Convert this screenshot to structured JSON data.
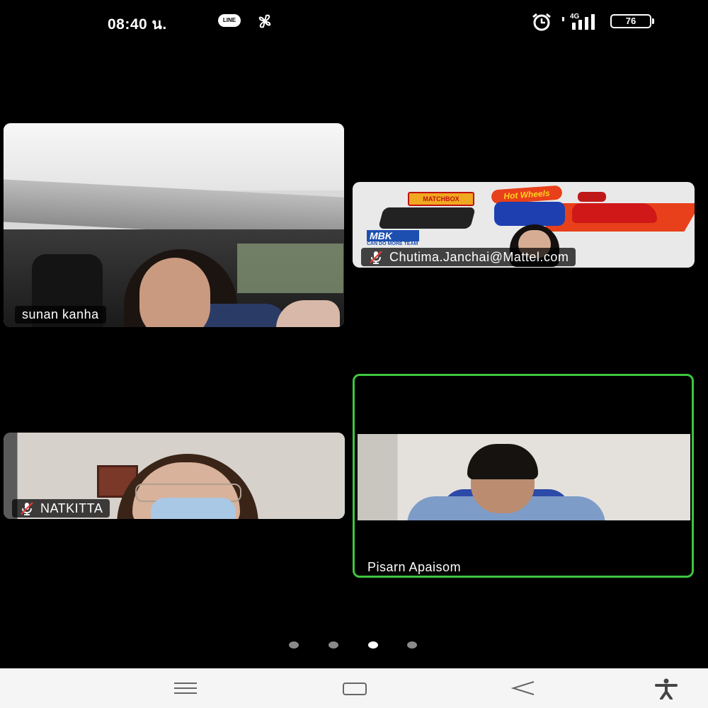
{
  "status_bar": {
    "time": "08:40 น.",
    "line_badge": "LINE",
    "network": "4G",
    "battery": "76",
    "icons": [
      "line-icon",
      "pinwheel-icon",
      "alarm-icon",
      "signal-icon",
      "battery-icon"
    ]
  },
  "participants": [
    {
      "name": "sunan kanha",
      "muted": false
    },
    {
      "name": "Chutima.Janchai@Mattel.com",
      "muted": true
    },
    {
      "name": "NATKITTA",
      "muted": true
    },
    {
      "name": "Pisarn Apaisom",
      "muted": false,
      "active_speaker": true
    }
  ],
  "chutima_background": {
    "brand_1": "MATCHBOX",
    "brand_2": "Hot Wheels",
    "logo": "MBK",
    "logo_sub": "CAN DO MORE TEAM"
  },
  "pagination": {
    "pages": 4,
    "current": 3
  },
  "colors": {
    "active_border": "#3ec63e",
    "background": "#000000",
    "nav_bar": "#f5f5f5"
  },
  "nav_bar": {
    "icons": [
      "menu-icon",
      "home-icon",
      "back-icon",
      "accessibility-icon"
    ]
  }
}
